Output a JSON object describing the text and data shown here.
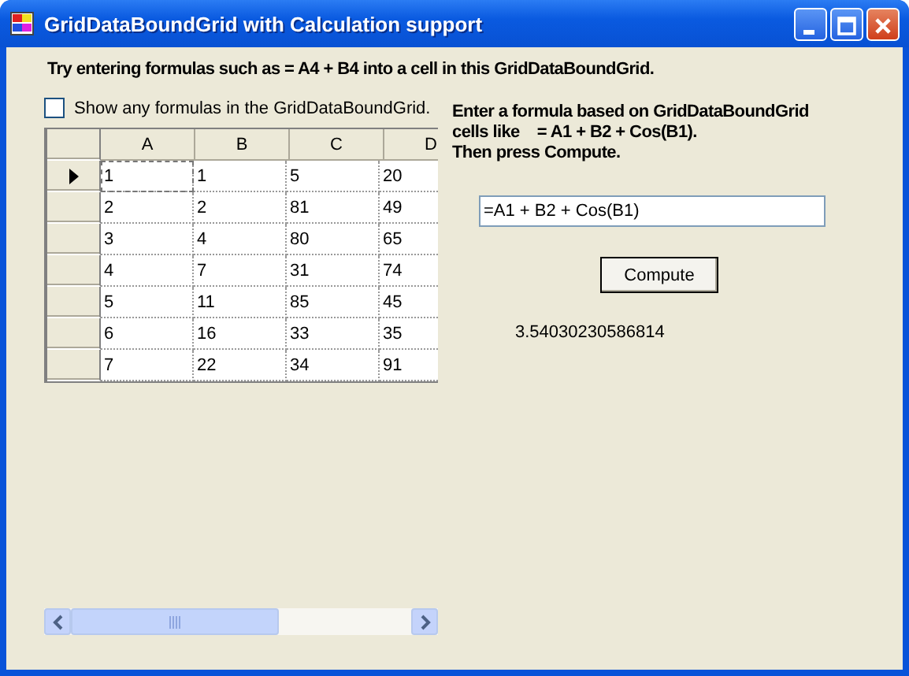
{
  "window": {
    "title": "GridDataBoundGrid with Calculation support"
  },
  "instructions": "Try entering formulas such as = A4 + B4 into a cell in this GridDataBoundGrid.",
  "show_formulas": {
    "label": "Show any formulas in the GridDataBoundGrid.",
    "checked": false
  },
  "grid": {
    "columns": [
      "A",
      "B",
      "C",
      "D"
    ],
    "rows": [
      {
        "cells": [
          "1",
          "1",
          "5",
          "20"
        ],
        "selected": true
      },
      {
        "cells": [
          "2",
          "2",
          "81",
          "49"
        ],
        "selected": false
      },
      {
        "cells": [
          "3",
          "4",
          "80",
          "65"
        ],
        "selected": false
      },
      {
        "cells": [
          "4",
          "7",
          "31",
          "74"
        ],
        "selected": false
      },
      {
        "cells": [
          "5",
          "11",
          "85",
          "45"
        ],
        "selected": false
      },
      {
        "cells": [
          "6",
          "16",
          "33",
          "35"
        ],
        "selected": false
      },
      {
        "cells": [
          "7",
          "22",
          "34",
          "91"
        ],
        "selected": false
      }
    ]
  },
  "formula_help": [
    "Enter a formula based on GridDataBoundGrid",
    "cells like    = A1 + B2 + Cos(B1).",
    "Then press Compute."
  ],
  "formula": {
    "value": "=A1 + B2 + Cos(B1)"
  },
  "compute_button": "Compute",
  "result": "3.54030230586814"
}
